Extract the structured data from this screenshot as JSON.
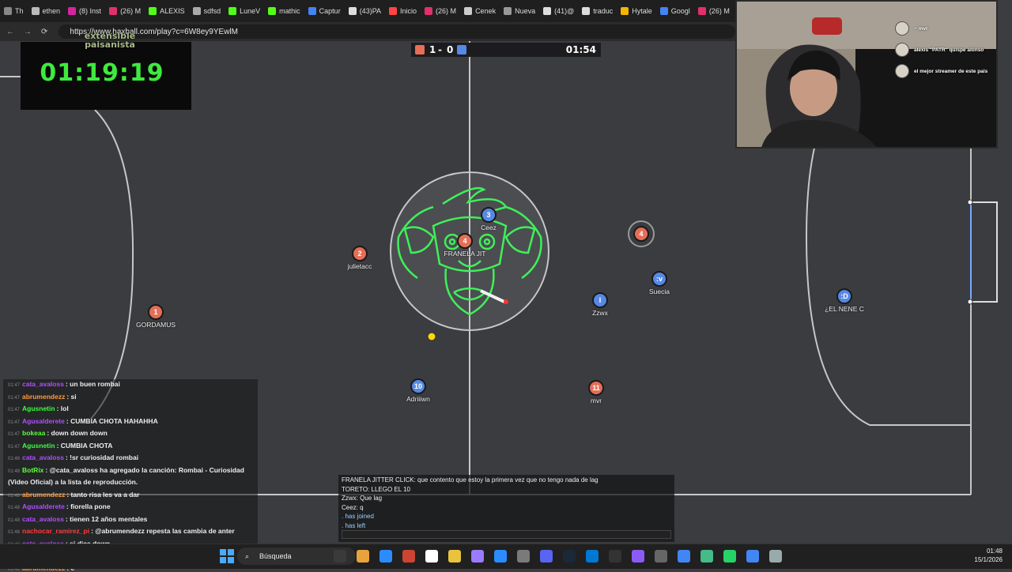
{
  "browser": {
    "tabs": [
      {
        "label": "Th",
        "color": "#888888"
      },
      {
        "label": "ethen",
        "color": "#bbbbbb"
      },
      {
        "label": "(8) Inst",
        "color": "#d6249f"
      },
      {
        "label": "(26) M",
        "color": "#e1306c"
      },
      {
        "label": "ALEXIS",
        "color": "#53fc18"
      },
      {
        "label": "sdfsd",
        "color": "#aaaaaa"
      },
      {
        "label": "LuneV",
        "color": "#53fc18"
      },
      {
        "label": "mathic",
        "color": "#53fc18"
      },
      {
        "label": "Captur",
        "color": "#4285f4"
      },
      {
        "label": "(43)PA",
        "color": "#dddddd"
      },
      {
        "label": "Inicio",
        "color": "#ff4444"
      },
      {
        "label": "(26) M",
        "color": "#e1306c"
      },
      {
        "label": "Cenek",
        "color": "#cccccc"
      },
      {
        "label": "Nueva",
        "color": "#999999"
      },
      {
        "label": "(41)@",
        "color": "#dddddd"
      },
      {
        "label": "traduc",
        "color": "#dddddd"
      },
      {
        "label": "Hytale",
        "color": "#f4b400"
      },
      {
        "label": "Googl",
        "color": "#4285f4"
      },
      {
        "label": "(26) M",
        "color": "#e1306c"
      }
    ],
    "url": "https://www.haxball.com/play?c=6W8ey9YEwlM"
  },
  "stream_timer": "01:19:19",
  "watermark": [
    "extensible",
    "paisanista"
  ],
  "scoreboard": {
    "red_score": "1",
    "separator": "-",
    "blue_score": "0",
    "time": "01:54",
    "red_color": "#e56e56",
    "blue_color": "#5689e5"
  },
  "players": [
    {
      "number": "3",
      "name": "Ceez",
      "team": "blue"
    },
    {
      "number": "4",
      "name": "FRANELA JIT",
      "team": "red"
    },
    {
      "number": "2",
      "name": "julietacc",
      "team": "red"
    },
    {
      "number": "1",
      "name": "GORDAMUS",
      "team": "red"
    },
    {
      "number": "10",
      "name": "Adriiiwn",
      "team": "blue"
    },
    {
      "number": "11",
      "name": "mvr",
      "team": "red"
    },
    {
      "number": "I",
      "name": "Zzwx",
      "team": "blue"
    },
    {
      "number": ":v",
      "name": "Suecia",
      "team": "blue"
    },
    {
      "number": ":D",
      "name": "¿EL NENE C",
      "team": "blue"
    },
    {
      "number": "4",
      "name": "",
      "team": "red"
    }
  ],
  "webcam_overlay": [
    {
      "user": "~ mvr"
    },
    {
      "user": "alexis \"PATR\" quispe alonso"
    },
    {
      "user": "el mejor streamer de este pais"
    }
  ],
  "stream_chat": [
    {
      "time": "01:47",
      "user": "cata_avaloss",
      "user_color": "#b04fff",
      "text": ": un buen rombai"
    },
    {
      "time": "01:47",
      "user": "abrumendezz",
      "user_color": "#ff9a3c",
      "text": ": si"
    },
    {
      "time": "01:47",
      "user": "Agusnetin",
      "user_color": "#3cff3c",
      "text": ": lol"
    },
    {
      "time": "01:47",
      "user": "Agusalderete",
      "user_color": "#b04fff",
      "text": ": CUMBIA CHOTA HAHAHHA"
    },
    {
      "time": "01:47",
      "user": "bokeaa",
      "user_color": "#5aff3c",
      "text": ": down down down"
    },
    {
      "time": "01:47",
      "user": "Agusnetin",
      "user_color": "#3cff3c",
      "text": ": CUMBIA CHOTA"
    },
    {
      "time": "01:48",
      "user": "cata_avaloss",
      "user_color": "#b04fff",
      "text": ": !sr curiosidad rombai"
    },
    {
      "time": "01:48",
      "user": "BotRix",
      "user_color": "#5aff3c",
      "text": ": @cata_avaloss ha agregado la canción: Rombai - Curiosidad"
    },
    {
      "time": "",
      "user": "",
      "user_color": "#ffffff",
      "text": "(Video Oficial) a la lista de reproducción."
    },
    {
      "time": "01:48",
      "user": "abrumendezz",
      "user_color": "#ff9a3c",
      "text": ": tanto risa les va a dar"
    },
    {
      "time": "01:48",
      "user": "Agusalderete",
      "user_color": "#b04fff",
      "text": ": fiorella pone"
    },
    {
      "time": "01:48",
      "user": "cata_avaloss",
      "user_color": "#b04fff",
      "text": ": tienen 12 años mentales"
    },
    {
      "time": "01:48",
      "user": "nachocar_ramirez_pi",
      "user_color": "#ff3c3c",
      "text": ": @abrumendezz repesta las cambia de anter"
    },
    {
      "time": "01:48",
      "user": "cata_avaloss",
      "user_color": "#b04fff",
      "text": ": si dice down"
    },
    {
      "time": "01:48",
      "user": "bokeaa",
      "user_color": "#5aff3c",
      "text": ": si"
    },
    {
      "time": "01:48",
      "user": "abrumendezz",
      "user_color": "#ff9a3c",
      "text": ": e"
    }
  ],
  "game_chat": [
    {
      "text": "FRANELA JITTER CLICK: que contento que estoy la primera vez que no tengo nada de lag",
      "color": "#eeeeee"
    },
    {
      "text": "TORETO: LLEGO EL 10",
      "color": "#eeeeee"
    },
    {
      "text": "Zzwx: Que lag",
      "color": "#eeeeee"
    },
    {
      "text": "Ceez: q",
      "color": "#eeeeee"
    },
    {
      "text": ". has joined",
      "color": "#9ad0ff"
    },
    {
      "text": ". has left",
      "color": "#9ad0ff"
    }
  ],
  "taskbar": {
    "search_placeholder": "Búsqueda",
    "time": "01:48",
    "date": "15/1/2026"
  }
}
